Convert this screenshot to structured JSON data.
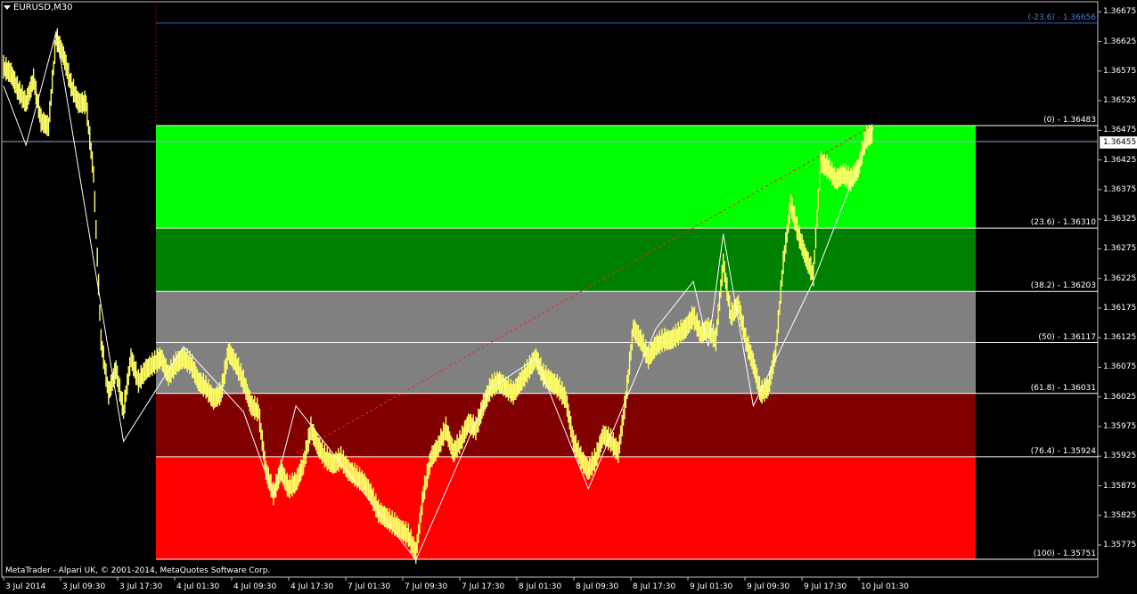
{
  "window": {
    "symbol": "EURUSD,M30",
    "copyright": "MetaTrader - Alpari UK, © 2001-2014, MetaQuotes Software Corp."
  },
  "price_axis": {
    "ticks": [
      "1.36675",
      "1.36625",
      "1.36575",
      "1.36525",
      "1.36475",
      "1.36425",
      "1.36375",
      "1.36325",
      "1.36275",
      "1.36225",
      "1.36175",
      "1.36125",
      "1.36075",
      "1.36025",
      "1.35975",
      "1.35925",
      "1.35875",
      "1.35825",
      "1.35775"
    ],
    "current_price": "1.36455"
  },
  "time_axis": {
    "ticks": [
      "3 Jul 2014",
      "3 Jul 09:30",
      "3 Jul 17:30",
      "4 Jul 01:30",
      "4 Jul 09:30",
      "4 Jul 17:30",
      "7 Jul 01:30",
      "7 Jul 09:30",
      "7 Jul 17:30",
      "8 Jul 01:30",
      "8 Jul 09:30",
      "8 Jul 17:30",
      "9 Jul 01:30",
      "9 Jul 09:30",
      "9 Jul 17:30",
      "10 Jul 01:30"
    ]
  },
  "fibonacci": {
    "levels": [
      {
        "label": "(-23.6) - 1.36656",
        "price": 1.36656,
        "color": "#4a7fd4"
      },
      {
        "label": "(0) - 1.36483",
        "price": 1.36483,
        "color": "#ffffff",
        "accent": "#4a7fd4"
      },
      {
        "label": "(23.6) - 1.36310",
        "price": 1.3631,
        "color": "#ffffff"
      },
      {
        "label": "(38.2) - 1.36203",
        "price": 1.36203,
        "color": "#ffffff"
      },
      {
        "label": "(50) - 1.36117",
        "price": 1.36117,
        "color": "#ffffff"
      },
      {
        "label": "(61.8) - 1.36031",
        "price": 1.36031,
        "color": "#ffffff"
      },
      {
        "label": "(76.4) - 1.35924",
        "price": 1.35924,
        "color": "#ffffff"
      },
      {
        "label": "(100) - 1.35751",
        "price": 1.35751,
        "color": "#ffffff",
        "accent": "#4a7fd4"
      }
    ],
    "zones": [
      {
        "from": 1.36483,
        "to": 1.3631,
        "color": "#00ff00"
      },
      {
        "from": 1.3631,
        "to": 1.36203,
        "color": "#008000"
      },
      {
        "from": 1.36203,
        "to": 1.36031,
        "color": "#808080"
      },
      {
        "from": 1.36031,
        "to": 1.35924,
        "color": "#800000"
      },
      {
        "from": 1.35924,
        "to": 1.35751,
        "color": "#ff0000"
      }
    ]
  },
  "chart_data": {
    "type": "candlestick",
    "instrument": "EURUSD",
    "timeframe": "M30",
    "ylim": [
      1.35751,
      1.36675
    ],
    "price_series_color": "#ffff66",
    "close_path": [
      [
        0,
        1.3658
      ],
      [
        0.02,
        1.3657
      ],
      [
        0.04,
        1.3654
      ],
      [
        0.06,
        1.3652
      ],
      [
        0.08,
        1.3656
      ],
      [
        0.1,
        1.3649
      ],
      [
        0.12,
        1.3648
      ],
      [
        0.14,
        1.3663
      ],
      [
        0.16,
        1.366
      ],
      [
        0.18,
        1.3655
      ],
      [
        0.2,
        1.3652
      ],
      [
        0.22,
        1.3652
      ],
      [
        0.24,
        1.364
      ],
      [
        0.26,
        1.3612
      ],
      [
        0.28,
        1.3603
      ],
      [
        0.3,
        1.3607
      ],
      [
        0.32,
        1.36
      ],
      [
        0.34,
        1.3609
      ],
      [
        0.36,
        1.3605
      ],
      [
        0.38,
        1.3607
      ],
      [
        0.4,
        1.3608
      ],
      [
        0.42,
        1.3609
      ],
      [
        0.44,
        1.3606
      ],
      [
        0.46,
        1.3608
      ],
      [
        0.48,
        1.3609
      ],
      [
        0.5,
        1.3608
      ],
      [
        0.52,
        1.3605
      ],
      [
        0.54,
        1.3604
      ],
      [
        0.56,
        1.3602
      ],
      [
        0.58,
        1.3603
      ],
      [
        0.6,
        1.361
      ],
      [
        0.62,
        1.3608
      ],
      [
        0.64,
        1.3605
      ],
      [
        0.66,
        1.3601
      ],
      [
        0.68,
        1.36
      ],
      [
        0.7,
        1.359
      ],
      [
        0.72,
        1.3586
      ],
      [
        0.74,
        1.359
      ],
      [
        0.76,
        1.3587
      ],
      [
        0.78,
        1.3588
      ],
      [
        0.8,
        1.3591
      ],
      [
        0.82,
        1.3597
      ],
      [
        0.84,
        1.3594
      ],
      [
        0.86,
        1.3592
      ],
      [
        0.88,
        1.3591
      ],
      [
        0.9,
        1.3592
      ],
      [
        0.92,
        1.359
      ],
      [
        0.94,
        1.3589
      ],
      [
        0.96,
        1.3588
      ],
      [
        0.98,
        1.3586
      ],
      [
        1.0,
        1.3583
      ],
      [
        1.02,
        1.3582
      ],
      [
        1.04,
        1.3581
      ],
      [
        1.06,
        1.358
      ],
      [
        1.08,
        1.3579
      ],
      [
        1.1,
        1.3576
      ],
      [
        1.12,
        1.3586
      ],
      [
        1.14,
        1.3592
      ],
      [
        1.16,
        1.3594
      ],
      [
        1.18,
        1.3597
      ],
      [
        1.2,
        1.3593
      ],
      [
        1.22,
        1.3595
      ],
      [
        1.24,
        1.3598
      ],
      [
        1.26,
        1.3597
      ],
      [
        1.28,
        1.3601
      ],
      [
        1.3,
        1.3604
      ],
      [
        1.32,
        1.3605
      ],
      [
        1.34,
        1.3604
      ],
      [
        1.36,
        1.3603
      ],
      [
        1.38,
        1.3605
      ],
      [
        1.4,
        1.3607
      ],
      [
        1.42,
        1.3609
      ],
      [
        1.44,
        1.3606
      ],
      [
        1.46,
        1.3605
      ],
      [
        1.48,
        1.3604
      ],
      [
        1.5,
        1.3602
      ],
      [
        1.52,
        1.3595
      ],
      [
        1.54,
        1.3592
      ],
      [
        1.56,
        1.359
      ],
      [
        1.58,
        1.3592
      ],
      [
        1.6,
        1.3596
      ],
      [
        1.62,
        1.3595
      ],
      [
        1.64,
        1.3593
      ],
      [
        1.66,
        1.3602
      ],
      [
        1.68,
        1.3614
      ],
      [
        1.7,
        1.3612
      ],
      [
        1.72,
        1.3609
      ],
      [
        1.74,
        1.3611
      ],
      [
        1.76,
        1.3612
      ],
      [
        1.78,
        1.3612
      ],
      [
        1.8,
        1.3613
      ],
      [
        1.82,
        1.3614
      ],
      [
        1.84,
        1.3616
      ],
      [
        1.86,
        1.3613
      ],
      [
        1.88,
        1.3614
      ],
      [
        1.9,
        1.3612
      ],
      [
        1.92,
        1.3625
      ],
      [
        1.94,
        1.3616
      ],
      [
        1.96,
        1.3618
      ],
      [
        1.98,
        1.3612
      ],
      [
        2.0,
        1.3608
      ],
      [
        2.02,
        1.3603
      ],
      [
        2.04,
        1.3604
      ],
      [
        2.06,
        1.361
      ],
      [
        2.08,
        1.3625
      ],
      [
        2.1,
        1.3635
      ],
      [
        2.12,
        1.363
      ],
      [
        2.14,
        1.3626
      ],
      [
        2.16,
        1.3623
      ],
      [
        2.18,
        1.3642
      ],
      [
        2.2,
        1.3641
      ],
      [
        2.22,
        1.3639
      ],
      [
        2.24,
        1.364
      ],
      [
        2.26,
        1.3639
      ],
      [
        2.28,
        1.3641
      ],
      [
        2.3,
        1.3646
      ],
      [
        2.32,
        1.3647
      ]
    ],
    "zigzag": [
      [
        0,
        1.3655
      ],
      [
        0.06,
        1.3645
      ],
      [
        0.14,
        1.3664
      ],
      [
        0.32,
        1.3595
      ],
      [
        0.48,
        1.3611
      ],
      [
        0.64,
        1.36
      ],
      [
        0.72,
        1.3586
      ],
      [
        0.78,
        1.3601
      ],
      [
        1.1,
        1.3575
      ],
      [
        1.3,
        1.3604
      ],
      [
        1.42,
        1.3609
      ],
      [
        1.56,
        1.3587
      ],
      [
        1.74,
        1.3614
      ],
      [
        1.84,
        1.3622
      ],
      [
        1.88,
        1.3611
      ],
      [
        1.92,
        1.363
      ],
      [
        2.0,
        1.3601
      ],
      [
        2.16,
        1.3622
      ],
      [
        2.32,
        1.3648
      ]
    ],
    "trend_line": {
      "from": [
        0.78,
        1.3593
      ],
      "to": [
        2.32,
        1.36483
      ],
      "style": "dashed",
      "color": "#ff2020"
    }
  }
}
